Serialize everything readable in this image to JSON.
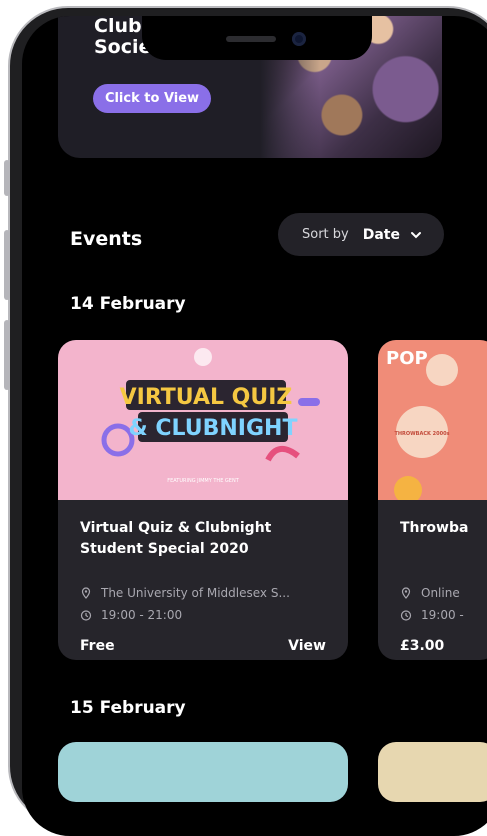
{
  "banner": {
    "title": "Club\nSocie",
    "button_label": "Click to View"
  },
  "events": {
    "heading": "Events",
    "sort_label": "Sort by",
    "sort_value": "Date"
  },
  "groups": [
    {
      "date": "14 February",
      "cards": [
        {
          "title": "Virtual Quiz & Clubnight\nStudent Special 2020",
          "location": "The University of Middlesex S...",
          "time": "19:00 - 21:00",
          "price": "Free",
          "action": "View",
          "poster_text": "VIRTUAL QUIZ & CLUBNIGHT",
          "poster_caption": "FEATURING JIMMY THE GENT"
        },
        {
          "title": "Throwba",
          "location": "Online",
          "time": "19:00 -",
          "price": "£3.00",
          "poster_text": "POP",
          "poster_caption": "THROWBACK 2000s"
        }
      ]
    },
    {
      "date": "15 February"
    }
  ],
  "colors": {
    "accent": "#8a6fe8",
    "card_bg": "#26252b",
    "screen_bg": "#000000"
  }
}
